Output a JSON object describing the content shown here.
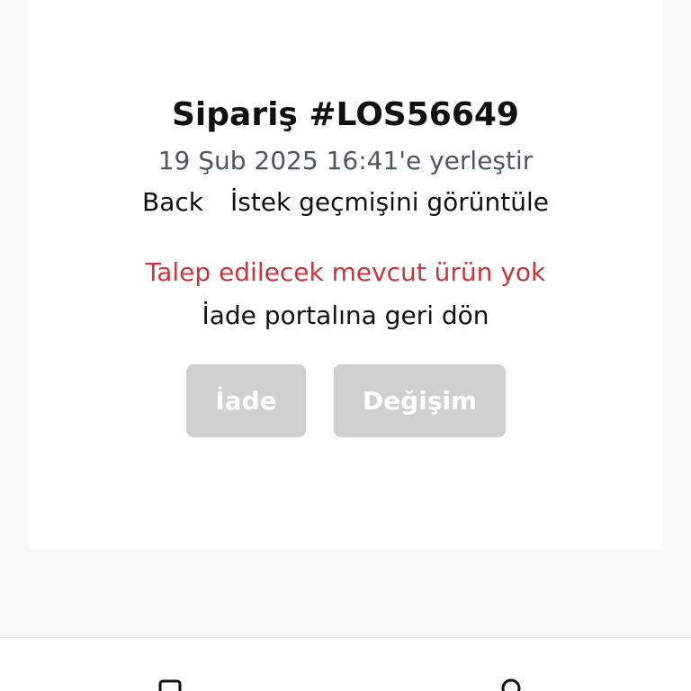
{
  "order": {
    "title": "Sipariş #LOS56649",
    "placed": "19 Şub 2025 16:41'e yerleştir"
  },
  "links": {
    "back": "Back",
    "history": "İstek geçmişini görüntüle"
  },
  "message": {
    "error": "Talep edilecek mevcut ürün yok",
    "return_portal": "İade portalına geri dön"
  },
  "buttons": {
    "return": "İade",
    "exchange": "Değişim"
  },
  "bottom_nav": {
    "left_icon": "document-icon",
    "right_icon": "user-icon"
  },
  "colors": {
    "error": "#c9363c",
    "disabled_button": "#cfcfcf"
  }
}
